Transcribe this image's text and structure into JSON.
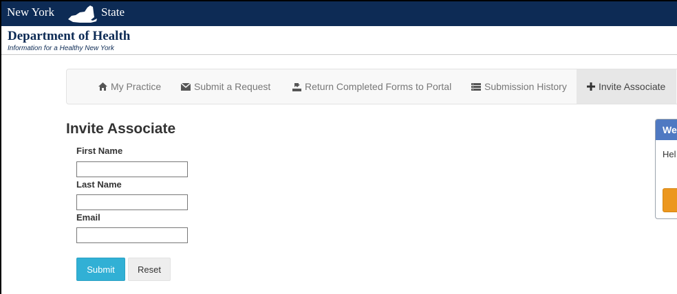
{
  "header": {
    "state_left": "New York",
    "state_right": "State",
    "department": "Department of Health",
    "tagline": "Information for a Healthy New York"
  },
  "nav": {
    "items": [
      {
        "label": "My Practice",
        "icon": "home-icon"
      },
      {
        "label": "Submit a Request",
        "icon": "envelope-icon"
      },
      {
        "label": "Return Completed Forms to Portal",
        "icon": "upload-icon"
      },
      {
        "label": "Submission History",
        "icon": "list-icon"
      },
      {
        "label": "Invite Associate",
        "icon": "plus-icon",
        "active": true
      }
    ]
  },
  "form": {
    "title": "Invite Associate",
    "first_name_label": "First Name",
    "first_name_value": "",
    "last_name_label": "Last Name",
    "last_name_value": "",
    "email_label": "Email",
    "email_value": "",
    "submit_label": "Submit",
    "reset_label": "Reset"
  },
  "side_panel": {
    "heading_partial": "We",
    "body_partial": "Hel"
  },
  "colors": {
    "header_bg": "#0d2b55",
    "panel_heading": "#4f79c2",
    "submit_button": "#31b0d5",
    "orange_button": "#ec971f"
  }
}
